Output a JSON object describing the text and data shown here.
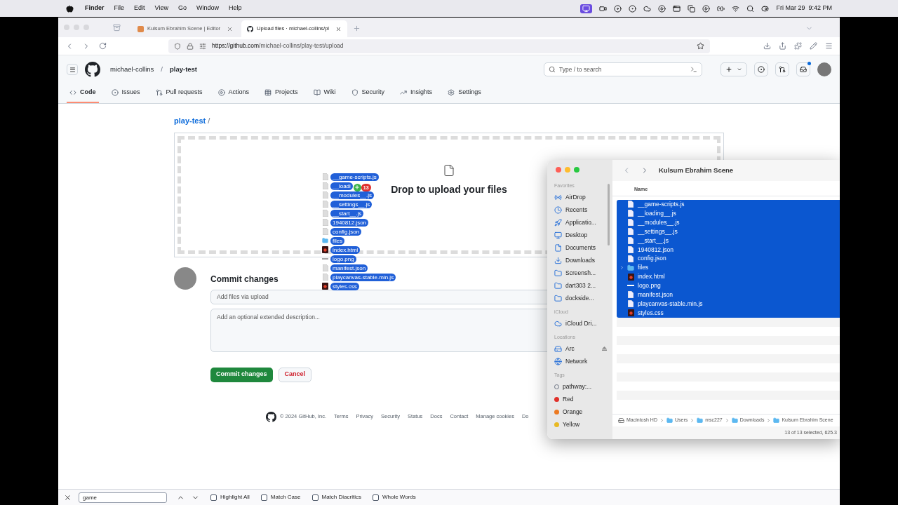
{
  "menu_bar": {
    "app": "Finder",
    "items": [
      "File",
      "Edit",
      "View",
      "Go",
      "Window",
      "Help"
    ],
    "clock": "Fri Mar 29  9:42 PM"
  },
  "browser": {
    "tabs": [
      {
        "title": "Kulsum Ebrahim Scene | Editor",
        "selected": false,
        "kind": "editor"
      },
      {
        "title": "Upload files · michael-collins/pl",
        "selected": true,
        "kind": "github"
      }
    ],
    "url_host": "https://github.com",
    "url_path": "/michael-collins/play-test/upload"
  },
  "github": {
    "owner": "michael-collins",
    "repo": "play-test",
    "search_placeholder": "Type / to search",
    "nav": [
      {
        "label": "Code",
        "kind": "code",
        "selected": true
      },
      {
        "label": "Issues",
        "kind": "issues",
        "selected": false
      },
      {
        "label": "Pull requests",
        "kind": "pulls",
        "selected": false
      },
      {
        "label": "Actions",
        "kind": "actions",
        "selected": false
      },
      {
        "label": "Projects",
        "kind": "projects",
        "selected": false
      },
      {
        "label": "Wiki",
        "kind": "wiki",
        "selected": false
      },
      {
        "label": "Security",
        "kind": "security",
        "selected": false
      },
      {
        "label": "Insights",
        "kind": "insights",
        "selected": false
      },
      {
        "label": "Settings",
        "kind": "settings",
        "selected": false
      }
    ],
    "breadcrumb": "play-test",
    "breadcrumb_sep": "/",
    "drop_text": "Drop to upload your files",
    "commit": {
      "title": "Commit changes",
      "summary_placeholder": "Add files via upload",
      "description_placeholder": "Add an optional extended description...",
      "submit": "Commit changes",
      "cancel": "Cancel"
    },
    "footer": {
      "copyright": "© 2024 GitHub, Inc.",
      "links": [
        "Terms",
        "Privacy",
        "Security",
        "Status",
        "Docs",
        "Contact",
        "Manage cookies",
        "Do"
      ]
    }
  },
  "drag_preview": {
    "count": "13",
    "items": [
      {
        "name": "__game-scripts.js",
        "kind": "file"
      },
      {
        "name": "__loadi",
        "kind": "file"
      },
      {
        "name": "__modules__.js",
        "kind": "file"
      },
      {
        "name": "__settings__.js",
        "kind": "file"
      },
      {
        "name": "__start__.js",
        "kind": "file"
      },
      {
        "name": "1940812.json",
        "kind": "file"
      },
      {
        "name": "config.json",
        "kind": "file"
      },
      {
        "name": "files",
        "kind": "folder"
      },
      {
        "name": "index.html",
        "kind": "html"
      },
      {
        "name": "logo.png",
        "kind": "image"
      },
      {
        "name": "manifest.json",
        "kind": "file"
      },
      {
        "name": "playcanvas-stable.min.js",
        "kind": "file"
      },
      {
        "name": "styles.css",
        "kind": "html"
      }
    ]
  },
  "finder": {
    "title": "Kulsum Ebrahim Scene",
    "column": "Name",
    "sidebar": [
      {
        "heading": "Favorites",
        "items": [
          {
            "label": "AirDrop",
            "kind": "airdrop"
          },
          {
            "label": "Recents",
            "kind": "recents"
          },
          {
            "label": "Applicatio...",
            "kind": "apps"
          },
          {
            "label": "Desktop",
            "kind": "desktop"
          },
          {
            "label": "Documents",
            "kind": "documents"
          },
          {
            "label": "Downloads",
            "kind": "downloads"
          },
          {
            "label": "Screensh...",
            "kind": "folder"
          },
          {
            "label": "dart303 2...",
            "kind": "folder"
          },
          {
            "label": "dockside...",
            "kind": "folder"
          }
        ]
      },
      {
        "heading": "iCloud",
        "items": [
          {
            "label": "iCloud Dri...",
            "kind": "cloud"
          }
        ]
      },
      {
        "heading": "Locations",
        "items": [
          {
            "label": "Arc",
            "kind": "drive"
          },
          {
            "label": "Network",
            "kind": "network"
          }
        ]
      },
      {
        "heading": "Tags",
        "items": [
          {
            "label": "pathway:...",
            "kind": "tag"
          },
          {
            "label": "Red",
            "kind": "tag",
            "color": "#e0302a"
          },
          {
            "label": "Orange",
            "kind": "tag",
            "color": "#ec7a22"
          },
          {
            "label": "Yellow",
            "kind": "tag",
            "color": "#e8b923"
          }
        ]
      }
    ],
    "files": [
      {
        "name": "__game-scripts.js",
        "kind": "file",
        "selected": true
      },
      {
        "name": "__loading__.js",
        "kind": "file",
        "selected": true
      },
      {
        "name": "__modules__.js",
        "kind": "file",
        "selected": true
      },
      {
        "name": "__settings__.js",
        "kind": "file",
        "selected": true
      },
      {
        "name": "__start__.js",
        "kind": "file",
        "selected": true
      },
      {
        "name": "1940812.json",
        "kind": "file",
        "selected": true
      },
      {
        "name": "config.json",
        "kind": "file",
        "selected": true
      },
      {
        "name": "files",
        "kind": "folder",
        "selected": true,
        "expanded": false
      },
      {
        "name": "index.html",
        "kind": "html",
        "selected": true
      },
      {
        "name": "logo.png",
        "kind": "image",
        "selected": true
      },
      {
        "name": "manifest.json",
        "kind": "file",
        "selected": true
      },
      {
        "name": "playcanvas-stable.min.js",
        "kind": "file",
        "selected": true
      },
      {
        "name": "styles.css",
        "kind": "html",
        "selected": true
      }
    ],
    "path": [
      "Macintosh HD",
      "Users",
      "msc227",
      "Downloads",
      "Kulsum Ebrahim Scene"
    ],
    "status": "13 of 13 selected, 625.3"
  },
  "find_bar": {
    "value": "game",
    "options": [
      {
        "label": "Highlight All",
        "checked": false
      },
      {
        "label": "Match Case",
        "checked": false
      },
      {
        "label": "Match Diacritics",
        "checked": false
      },
      {
        "label": "Whole Words",
        "checked": false
      }
    ]
  }
}
